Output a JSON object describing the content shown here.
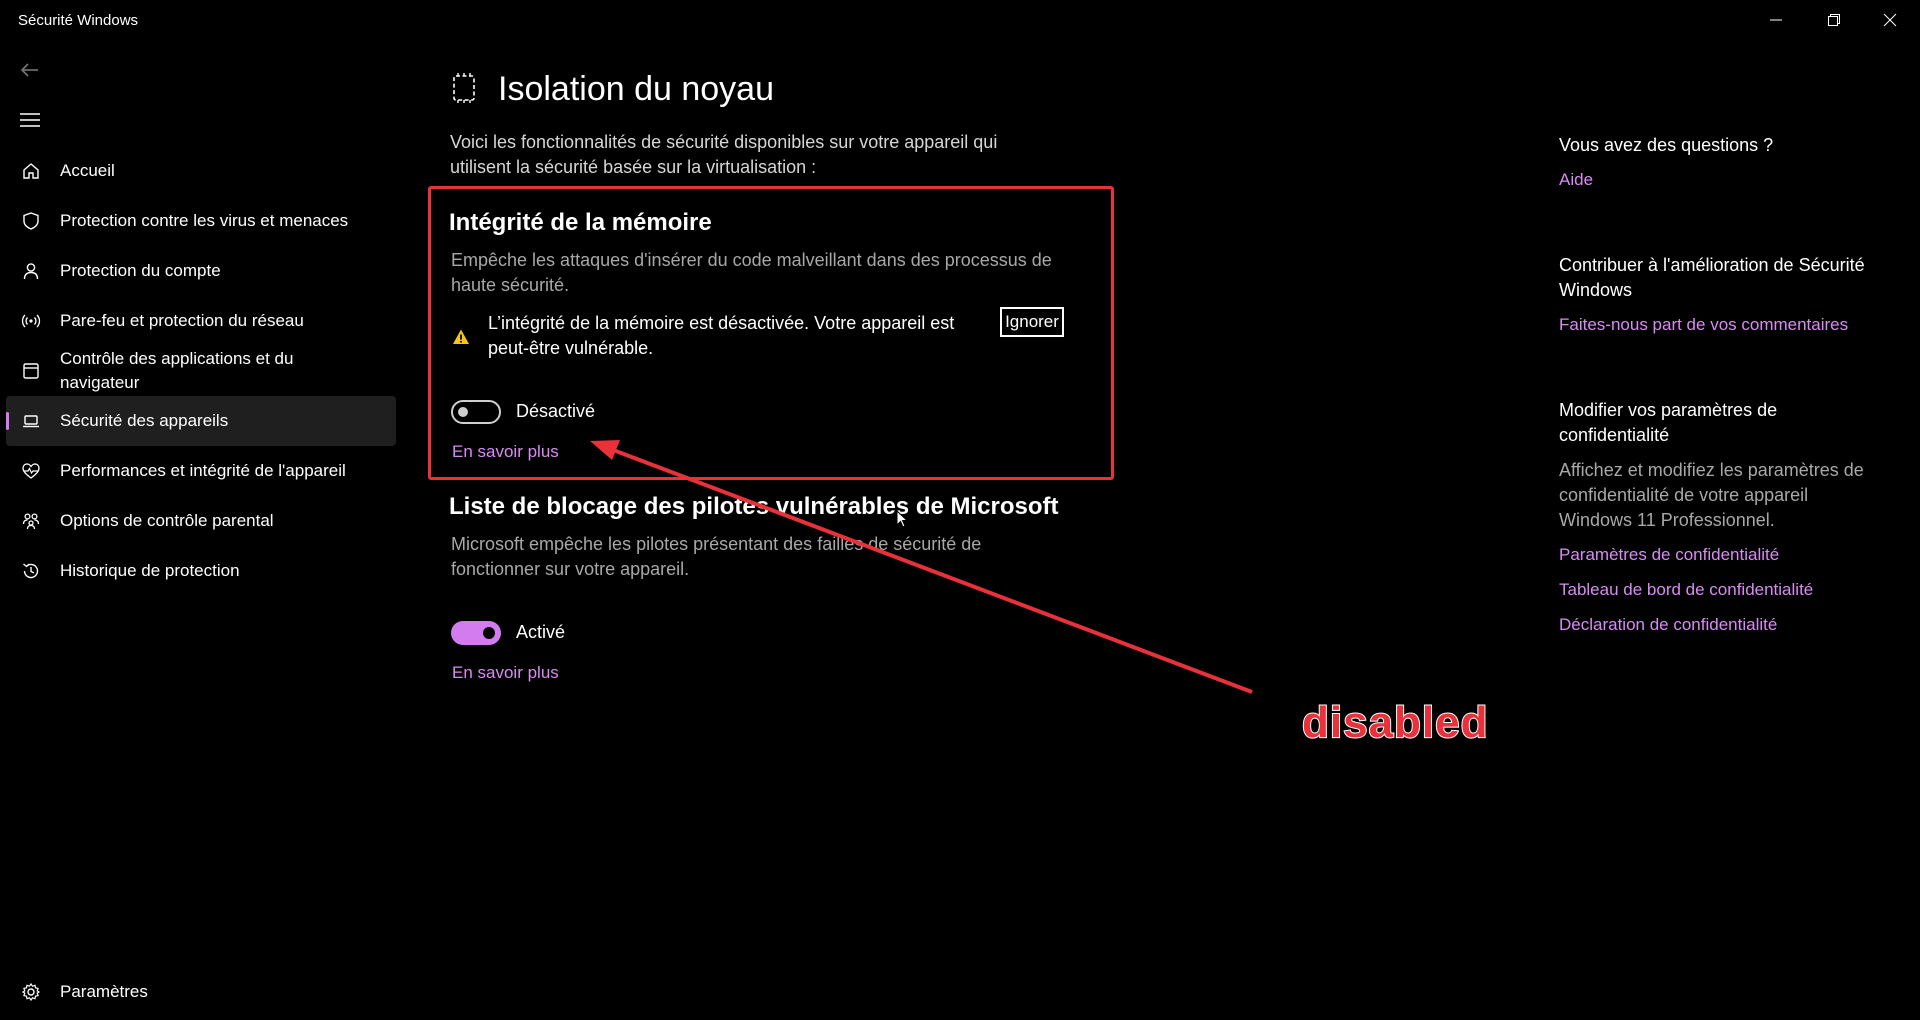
{
  "window": {
    "title": "Sécurité Windows"
  },
  "sidebar": {
    "items": [
      {
        "label": "Accueil",
        "icon": "home-icon"
      },
      {
        "label": "Protection contre les virus et menaces",
        "icon": "shield-icon"
      },
      {
        "label": "Protection du compte",
        "icon": "person-icon"
      },
      {
        "label": "Pare-feu et protection du réseau",
        "icon": "wifi-antenna-icon"
      },
      {
        "label": "Contrôle des applications et du navigateur",
        "icon": "browser-window-icon"
      },
      {
        "label": "Sécurité des appareils",
        "icon": "laptop-icon",
        "active": true
      },
      {
        "label": "Performances et intégrité de l'appareil",
        "icon": "heart-pulse-icon"
      },
      {
        "label": "Options de contrôle parental",
        "icon": "family-icon"
      },
      {
        "label": "Historique de protection",
        "icon": "history-icon"
      }
    ],
    "settings_label": "Paramètres"
  },
  "main": {
    "title": "Isolation du noyau",
    "intro": "Voici les fonctionnalités de sécurité disponibles sur votre appareil qui utilisent la sécurité basée sur la virtualisation :",
    "memory_integrity": {
      "title": "Intégrité de la mémoire",
      "description": "Empêche les attaques d'insérer du code malveillant dans des processus de haute sécurité.",
      "warning": "L’intégrité de la mémoire est désactivée. Votre appareil est peut-être vulnérable.",
      "ignore_label": "Ignorer",
      "toggle_label": "Désactivé",
      "toggle_on": false,
      "learn_more": "En savoir plus"
    },
    "driver_blocklist": {
      "title": "Liste de blocage des pilotes vulnérables de Microsoft",
      "description": "Microsoft empêche les pilotes présentant des failles de sécurité de fonctionner sur votre appareil.",
      "toggle_label": "Activé",
      "toggle_on": true,
      "learn_more": "En savoir plus"
    }
  },
  "annotation": {
    "text": "disabled",
    "color": "#e8313b"
  },
  "right_panel": {
    "questions": {
      "heading": "Vous avez des questions ?",
      "link": "Aide"
    },
    "improve": {
      "heading": "Contribuer à l'amélioration de Sécurité Windows",
      "link": "Faites-nous part de vos commentaires"
    },
    "privacy": {
      "heading": "Modifier vos paramètres de confidentialité",
      "text": "Affichez et modifiez les paramètres de confidentialité de votre appareil Windows 11 Professionnel.",
      "links": [
        "Paramètres de confidentialité",
        "Tableau de bord de confidentialité",
        "Déclaration de confidentialité"
      ]
    }
  },
  "colors": {
    "accent": "#d27cf0",
    "link": "#d78cf2",
    "warning": "#f5c518",
    "annotation": "#e8313b"
  }
}
